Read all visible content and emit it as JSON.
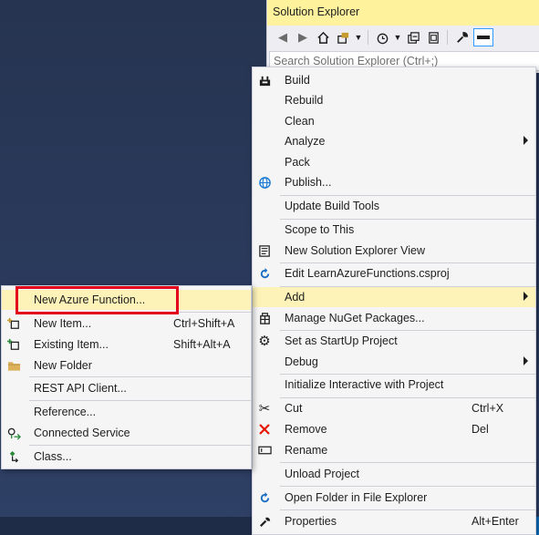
{
  "solution_explorer": {
    "title": "Solution Explorer",
    "search_placeholder": "Search Solution Explorer (Ctrl+;)",
    "toolbar_icons": [
      "back-arrow-icon",
      "forward-arrow-icon",
      "home-icon",
      "switch-views-icon",
      "dropdown-arrow-icon",
      "history-icon",
      "dropdown-arrow-icon",
      "collapse-all-icon",
      "show-all-files-icon",
      "properties-wrench-icon",
      "preview-selected-icon"
    ]
  },
  "context_menu": {
    "items": [
      {
        "label": "Build",
        "icon": "build-icon"
      },
      {
        "label": "Rebuild"
      },
      {
        "label": "Clean"
      },
      {
        "label": "Analyze",
        "submenu": true
      },
      {
        "label": "Pack"
      },
      {
        "label": "Publish...",
        "icon": "globe-icon"
      },
      {
        "label": "Update Build Tools"
      },
      {
        "label": "Scope to This"
      },
      {
        "label": "New Solution Explorer View",
        "icon": "new-view-icon"
      },
      {
        "label": "Edit LearnAzureFunctions.csproj",
        "icon": "refresh-icon"
      },
      {
        "label": "Add",
        "submenu": true,
        "highlighted": true
      },
      {
        "label": "Manage NuGet Packages...",
        "icon": "nuget-icon"
      },
      {
        "label": "Set as StartUp Project",
        "icon": "gear-icon"
      },
      {
        "label": "Debug",
        "submenu": true
      },
      {
        "label": "Initialize Interactive with Project"
      },
      {
        "label": "Cut",
        "icon": "scissors-icon",
        "shortcut": "Ctrl+X"
      },
      {
        "label": "Remove",
        "icon": "red-x-icon",
        "shortcut": "Del"
      },
      {
        "label": "Rename",
        "icon": "rename-icon"
      },
      {
        "label": "Unload Project"
      },
      {
        "label": "Open Folder in File Explorer",
        "icon": "refresh-icon"
      },
      {
        "label": "Properties",
        "icon": "wrench-icon",
        "shortcut": "Alt+Enter"
      }
    ]
  },
  "add_submenu": {
    "items": [
      {
        "label": "New Azure Function...",
        "highlighted": true
      },
      {
        "label": "New Item...",
        "icon": "new-item-icon",
        "shortcut": "Ctrl+Shift+A"
      },
      {
        "label": "Existing Item...",
        "icon": "existing-item-icon",
        "shortcut": "Shift+Alt+A"
      },
      {
        "label": "New Folder",
        "icon": "folder-icon"
      },
      {
        "label": "REST API Client..."
      },
      {
        "label": "Reference..."
      },
      {
        "label": "Connected Service",
        "icon": "connected-service-icon"
      },
      {
        "label": "Class...",
        "icon": "class-icon"
      }
    ]
  },
  "colors": {
    "title_bar": "#fff29d",
    "menu_bg": "#f5f5f5",
    "highlight_row": "#fdf3b8",
    "callout_border": "#e3001b",
    "remove_icon": "#e51400",
    "globe_icon": "#1a7ad4"
  }
}
